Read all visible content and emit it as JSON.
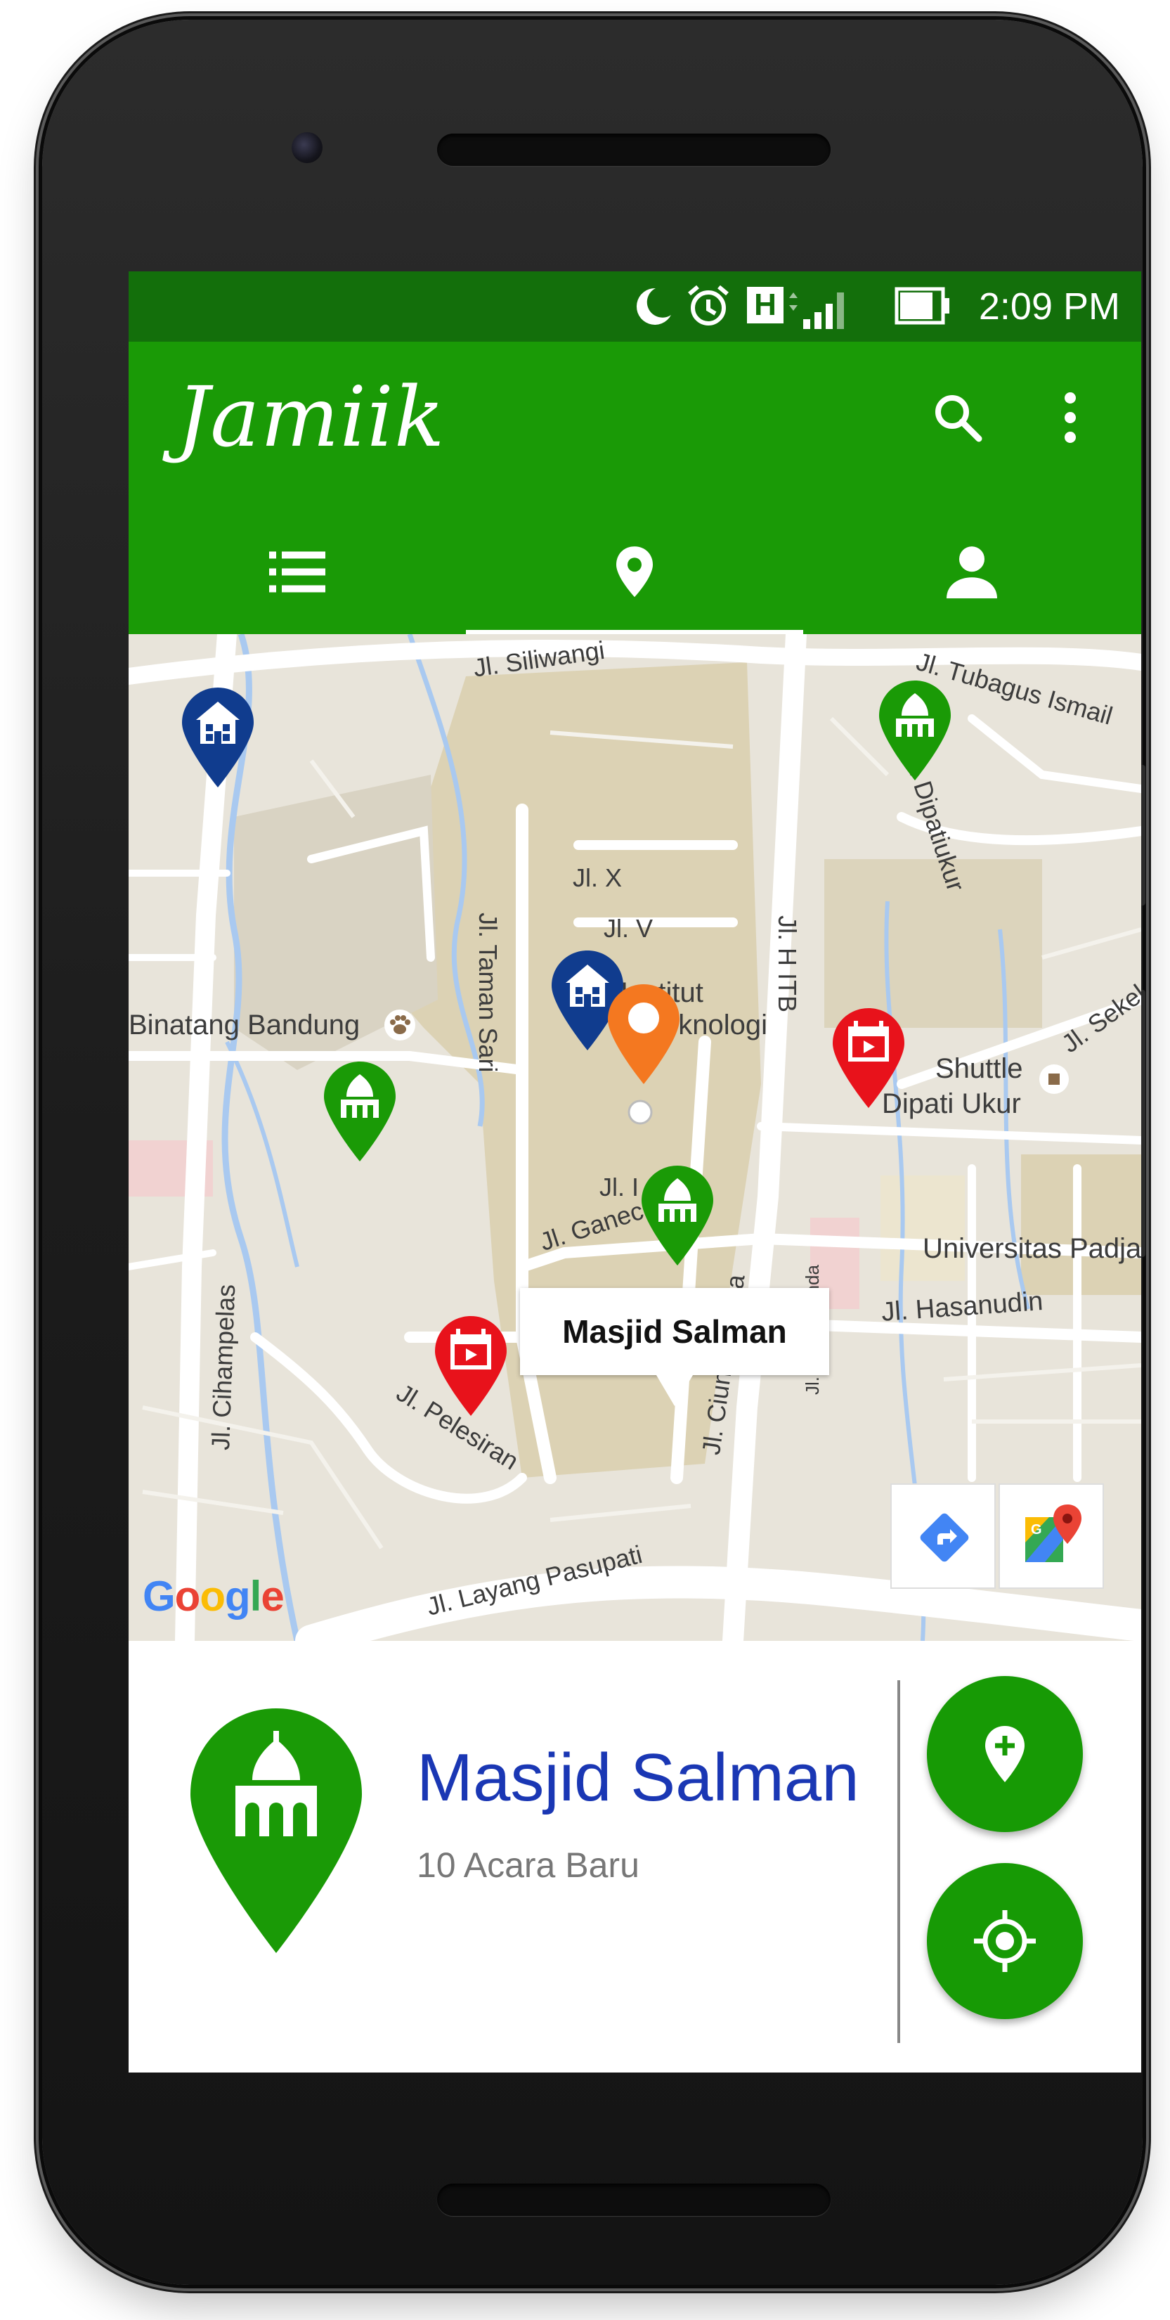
{
  "status_bar": {
    "time": "2:09 PM",
    "network_type": "H",
    "icons": [
      "moon-icon",
      "alarm-icon",
      "network-h-icon",
      "signal-icon",
      "battery-icon"
    ]
  },
  "app_bar": {
    "app_name": "Jamiik",
    "actions": [
      "search-icon",
      "more-vert-icon"
    ],
    "tabs": [
      {
        "icon": "list-icon",
        "selected": false
      },
      {
        "icon": "map-pin-icon",
        "selected": true
      },
      {
        "icon": "person-icon",
        "selected": false
      }
    ]
  },
  "map": {
    "road_labels": [
      "Jl. Siliwangi",
      "Jl. Tubagus Ismail",
      "Jl. Dipatiukur",
      "Jl. X",
      "Jl. V",
      "Jl. Taman Sari",
      "Jl. H ITB",
      "Jl. Sekel",
      "Jl. I",
      "Jl. Ganeca",
      "Jl. Cihampelas",
      "Jl. Pelesiran",
      "Jl. Ciungwanara",
      "Jl. Ir. H.Djuanda",
      "Jl. Hasanudin",
      "Jl. Layang Pasupati"
    ],
    "poi_labels": [
      "Binatang Bandung",
      "Institut",
      "Teknologi",
      "Shuttle",
      "Dipati Ukur",
      "Universitas Padja"
    ],
    "info_window": {
      "title": "Masjid Salman"
    },
    "attribution": "Google",
    "markers": [
      "mosque-marker-icon",
      "school-marker-icon",
      "event-marker-icon",
      "user-location-marker-icon"
    ],
    "tools": [
      "directions-icon",
      "google-maps-icon"
    ],
    "colors": {
      "mosque": "#1a9a06",
      "school": "#103c8e",
      "event": "#e8121b",
      "orange": "#f47820"
    }
  },
  "selected_place": {
    "name": "Masjid Salman",
    "subtitle": "10 Acara Baru",
    "icon": "mosque-marker-icon"
  },
  "fabs": [
    "add-location-icon",
    "my-location-icon"
  ],
  "colors": {
    "primary": "#1a9a06",
    "primary_dark": "#136f0b",
    "title_blue": "#1a37b4"
  }
}
